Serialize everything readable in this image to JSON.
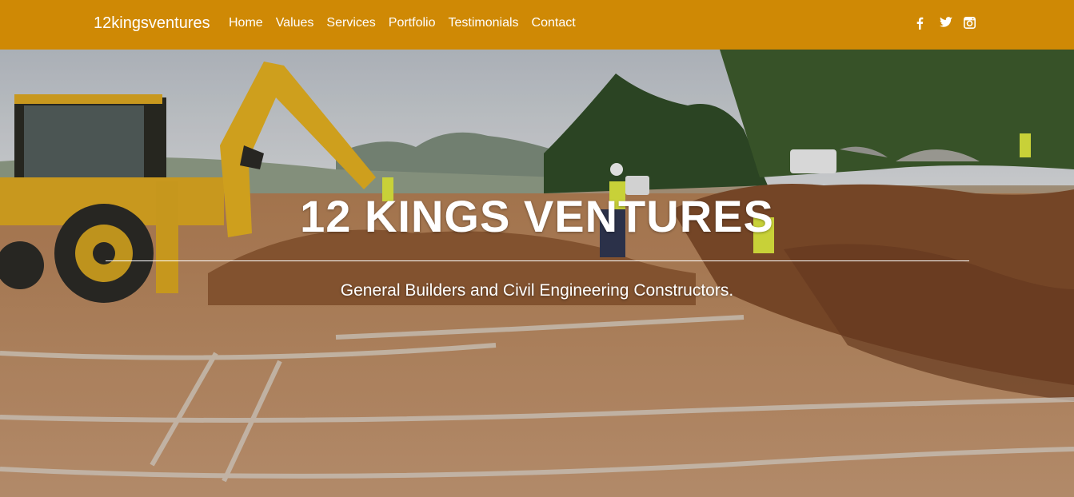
{
  "navbar": {
    "brand": "12kingsventures",
    "links": [
      "Home",
      "Values",
      "Services",
      "Portfolio",
      "Testimonials",
      "Contact"
    ],
    "social_icons": [
      "facebook-icon",
      "twitter-icon",
      "instagram-icon"
    ],
    "background_color": "#cf8905"
  },
  "hero": {
    "title": "12 KINGS VENTURES",
    "subtitle": "General Builders and Civil Engineering Constructors.",
    "image": "construction-site-photo"
  }
}
